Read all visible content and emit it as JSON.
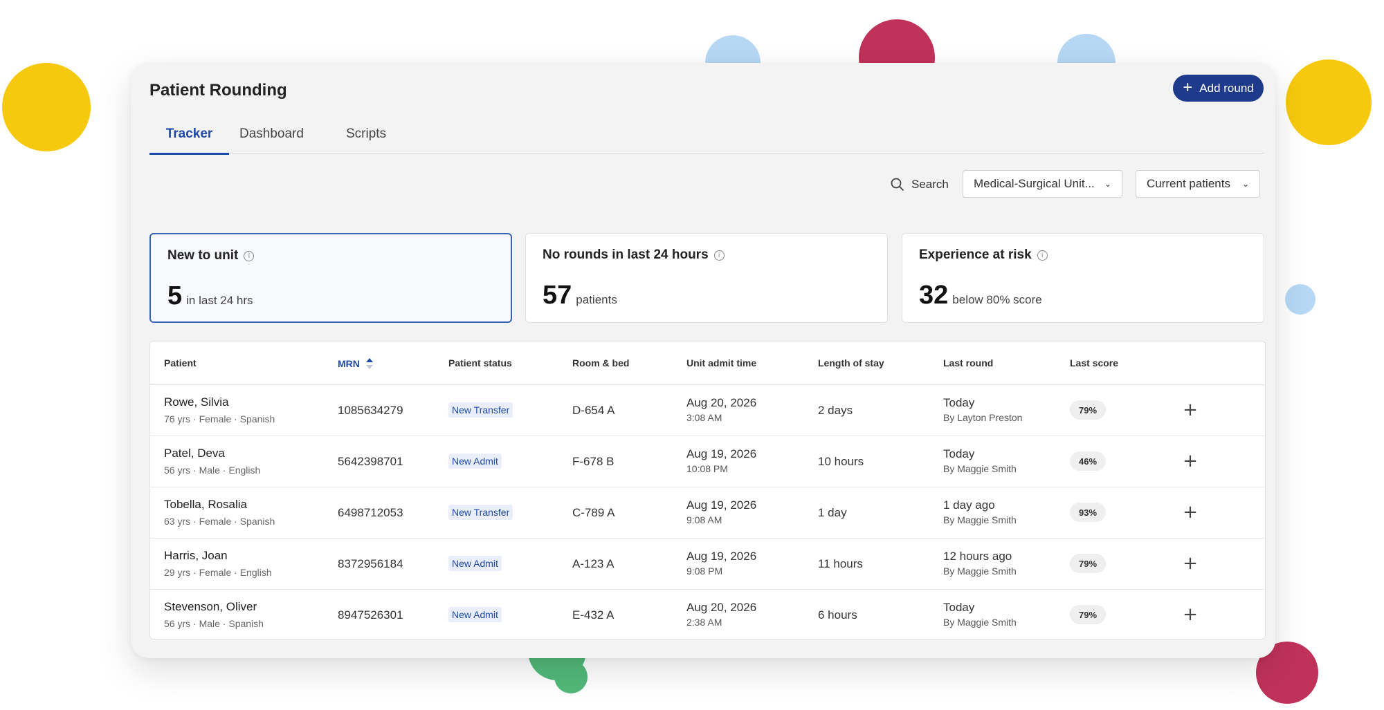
{
  "app": {
    "title": "Patient Rounding",
    "add_round_label": "Add round",
    "tabs": [
      {
        "label": "Tracker",
        "active": true
      },
      {
        "label": "Dashboard",
        "active": false
      },
      {
        "label": "Scripts",
        "active": false
      }
    ]
  },
  "filters": {
    "search_label": "Search",
    "unit_select": "Medical-Surgical Unit...",
    "patient_select": "Current patients"
  },
  "cards": [
    {
      "title": "New to unit",
      "value": "5",
      "unit": "in last 24 hrs",
      "selected": true
    },
    {
      "title": "No rounds in last 24 hours",
      "value": "57",
      "unit": "patients",
      "selected": false
    },
    {
      "title": "Experience at risk",
      "value": "32",
      "unit": "below 80% score",
      "selected": false
    }
  ],
  "table": {
    "headers": {
      "patient": "Patient",
      "mrn": "MRN",
      "status": "Patient status",
      "room": "Room & bed",
      "admit": "Unit admit time",
      "los": "Length of stay",
      "last_round": "Last round",
      "last_score": "Last score"
    },
    "rows": [
      {
        "name": "Rowe, Silvia",
        "details": "76 yrs · Female · Spanish",
        "mrn": "1085634279",
        "status": "New Transfer",
        "room": "D-654 A",
        "admit_date": "Aug 20, 2026",
        "admit_time": "3:08 AM",
        "los": "2 days",
        "round_when": "Today",
        "round_by": "By Layton Preston",
        "score": "79%"
      },
      {
        "name": "Patel, Deva",
        "details": "56 yrs · Male · English",
        "mrn": "5642398701",
        "status": "New Admit",
        "room": "F-678 B",
        "admit_date": "Aug 19, 2026",
        "admit_time": "10:08 PM",
        "los": "10 hours",
        "round_when": "Today",
        "round_by": "By Maggie Smith",
        "score": "46%"
      },
      {
        "name": "Tobella, Rosalia",
        "details": "63 yrs · Female · Spanish",
        "mrn": "6498712053",
        "status": "New Transfer",
        "room": "C-789 A",
        "admit_date": "Aug 19, 2026",
        "admit_time": "9:08 AM",
        "los": "1 day",
        "round_when": "1 day ago",
        "round_by": "By Maggie Smith",
        "score": "93%"
      },
      {
        "name": "Harris, Joan",
        "details": "29 yrs · Female · English",
        "mrn": "8372956184",
        "status": "New Admit",
        "room": "A-123 A",
        "admit_date": "Aug 19, 2026",
        "admit_time": "9:08 PM",
        "los": "11 hours",
        "round_when": "12 hours ago",
        "round_by": "By Maggie Smith",
        "score": "79%"
      },
      {
        "name": "Stevenson, Oliver",
        "details": "56 yrs · Male · Spanish",
        "mrn": "8947526301",
        "status": "New Admit",
        "room": "E-432 A",
        "admit_date": "Aug 20, 2026",
        "admit_time": "2:38 AM",
        "los": "6 hours",
        "round_when": "Today",
        "round_by": "By Maggie Smith",
        "score": "79%"
      }
    ]
  },
  "colors": {
    "accent": "#1e3a8a",
    "tab_active": "#1e49a8",
    "decor_yellow": "#f6c90e",
    "decor_blue": "#b6d8f5",
    "decor_crimson": "#c0325a",
    "decor_green": "#52b97a"
  },
  "icons": [
    "plus-icon",
    "search-icon",
    "chevron-down-icon",
    "info-icon",
    "sort-up-icon"
  ]
}
